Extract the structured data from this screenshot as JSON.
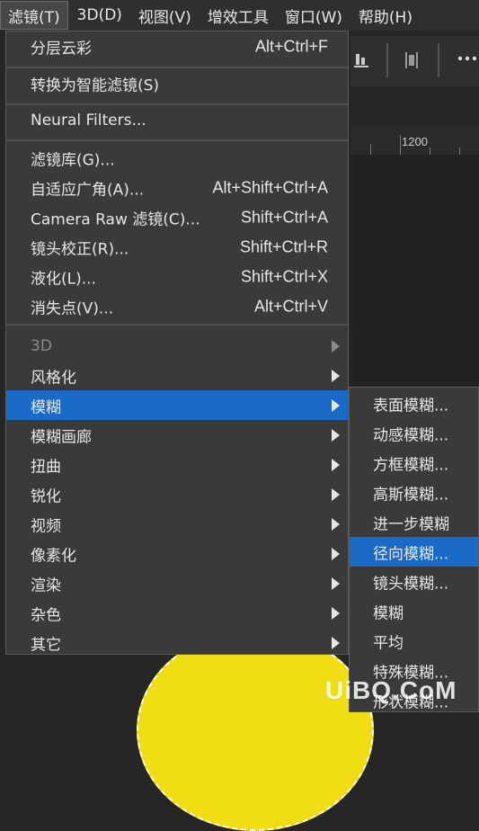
{
  "menubar": {
    "items": [
      {
        "label": "滤镜(T)"
      },
      {
        "label": "3D(D)"
      },
      {
        "label": "视图(V)"
      },
      {
        "label": "增效工具"
      },
      {
        "label": "窗口(W)"
      },
      {
        "label": "帮助(H)"
      }
    ]
  },
  "background": {
    "ruler_label": "1200",
    "accent_yellow": "#f0dd13"
  },
  "filter_menu": {
    "items": [
      {
        "label": "分层云彩",
        "shortcut": "Alt+Ctrl+F"
      },
      {
        "label": "转换为智能滤镜(S)",
        "shortcut": ""
      },
      {
        "label": "Neural Filters...",
        "shortcut": ""
      },
      {
        "label": "滤镜库(G)...",
        "shortcut": ""
      },
      {
        "label": "自适应广角(A)...",
        "shortcut": "Alt+Shift+Ctrl+A"
      },
      {
        "label": "Camera Raw 滤镜(C)...",
        "shortcut": "Shift+Ctrl+A"
      },
      {
        "label": "镜头校正(R)...",
        "shortcut": "Shift+Ctrl+R"
      },
      {
        "label": "液化(L)...",
        "shortcut": "Shift+Ctrl+X"
      },
      {
        "label": "消失点(V)...",
        "shortcut": "Alt+Ctrl+V"
      },
      {
        "label": "3D",
        "shortcut": ""
      },
      {
        "label": "风格化",
        "shortcut": ""
      },
      {
        "label": "模糊",
        "shortcut": ""
      },
      {
        "label": "模糊画廊",
        "shortcut": ""
      },
      {
        "label": "扭曲",
        "shortcut": ""
      },
      {
        "label": "锐化",
        "shortcut": ""
      },
      {
        "label": "视频",
        "shortcut": ""
      },
      {
        "label": "像素化",
        "shortcut": ""
      },
      {
        "label": "渲染",
        "shortcut": ""
      },
      {
        "label": "杂色",
        "shortcut": ""
      },
      {
        "label": "其它",
        "shortcut": ""
      }
    ]
  },
  "blur_submenu": {
    "items": [
      {
        "label": "表面模糊..."
      },
      {
        "label": "动感模糊..."
      },
      {
        "label": "方框模糊..."
      },
      {
        "label": "高斯模糊..."
      },
      {
        "label": "进一步模糊"
      },
      {
        "label": "径向模糊..."
      },
      {
        "label": "镜头模糊..."
      },
      {
        "label": "模糊"
      },
      {
        "label": "平均"
      },
      {
        "label": "特殊模糊..."
      },
      {
        "label": "形状模糊..."
      }
    ]
  },
  "watermark": {
    "text": "UiBQ.CoM"
  }
}
